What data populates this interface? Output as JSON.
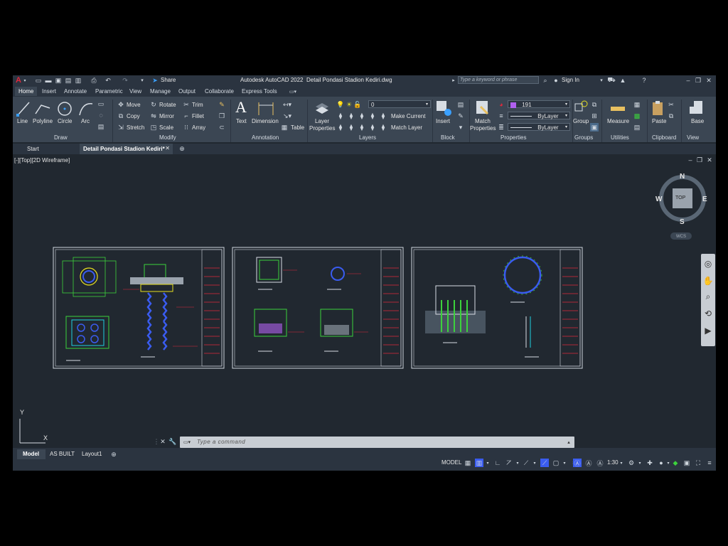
{
  "app": {
    "title": "Autodesk AutoCAD 2022",
    "filename": "Detail Pondasi Stadion Kediri.dwg",
    "share_label": "Share",
    "search_placeholder": "Type a keyword or phrase",
    "sign_in": "Sign In"
  },
  "ribbon_tabs": [
    "Home",
    "Insert",
    "Annotate",
    "Parametric",
    "View",
    "Manage",
    "Output",
    "Collaborate",
    "Express Tools"
  ],
  "draw_panel": {
    "title": "Draw",
    "line": "Line",
    "polyline": "Polyline",
    "circle": "Circle",
    "arc": "Arc"
  },
  "modify_panel": {
    "title": "Modify",
    "move": "Move",
    "rotate": "Rotate",
    "trim": "Trim",
    "copy": "Copy",
    "mirror": "Mirror",
    "fillet": "Fillet",
    "stretch": "Stretch",
    "scale": "Scale",
    "array": "Array"
  },
  "annotation_panel": {
    "title": "Annotation",
    "text": "Text",
    "dimension": "Dimension",
    "table": "Table"
  },
  "layers_panel": {
    "title": "Layers",
    "layer_properties_1": "Layer",
    "layer_properties_2": "Properties",
    "current_layer": "0",
    "make_current": "Make Current",
    "match_layer": "Match Layer"
  },
  "block_panel": {
    "title": "Block",
    "insert": "Insert"
  },
  "properties_panel": {
    "title": "Properties",
    "match_1": "Match",
    "match_2": "Properties",
    "color_value": "191",
    "linetype": "ByLayer",
    "lineweight": "ByLayer"
  },
  "groups_panel": {
    "title": "Groups",
    "group": "Group"
  },
  "utilities_panel": {
    "title": "Utilities",
    "measure": "Measure"
  },
  "clipboard_panel": {
    "title": "Clipboard",
    "paste": "Paste"
  },
  "view_panel": {
    "title": "View",
    "base": "Base"
  },
  "doc_tabs": {
    "start": "Start",
    "active": "Detail Pondasi Stadion Kediri*"
  },
  "viewport": {
    "label": "[-][Top][2D Wireframe]"
  },
  "viewcube": {
    "n": "N",
    "s": "S",
    "e": "E",
    "w": "W",
    "top": "TOP",
    "wcs": "WCS"
  },
  "ucs": {
    "y": "Y",
    "x": "X"
  },
  "command": {
    "placeholder": "Type a command"
  },
  "layout_tabs": [
    "Model",
    "AS BUILT",
    "Layout1"
  ],
  "status": {
    "model": "MODEL",
    "scale": "1:30"
  },
  "colors": {
    "background": "#212830",
    "ribbon": "#3b4653",
    "titlebar": "#2b3440",
    "accent_green": "#3cd23c",
    "accent_cyan": "#20d0e0",
    "accent_yellow": "#e8e020",
    "accent_red": "#e0283c",
    "accent_blue": "#3a5cf0",
    "accent_magenta": "#c040e0"
  }
}
